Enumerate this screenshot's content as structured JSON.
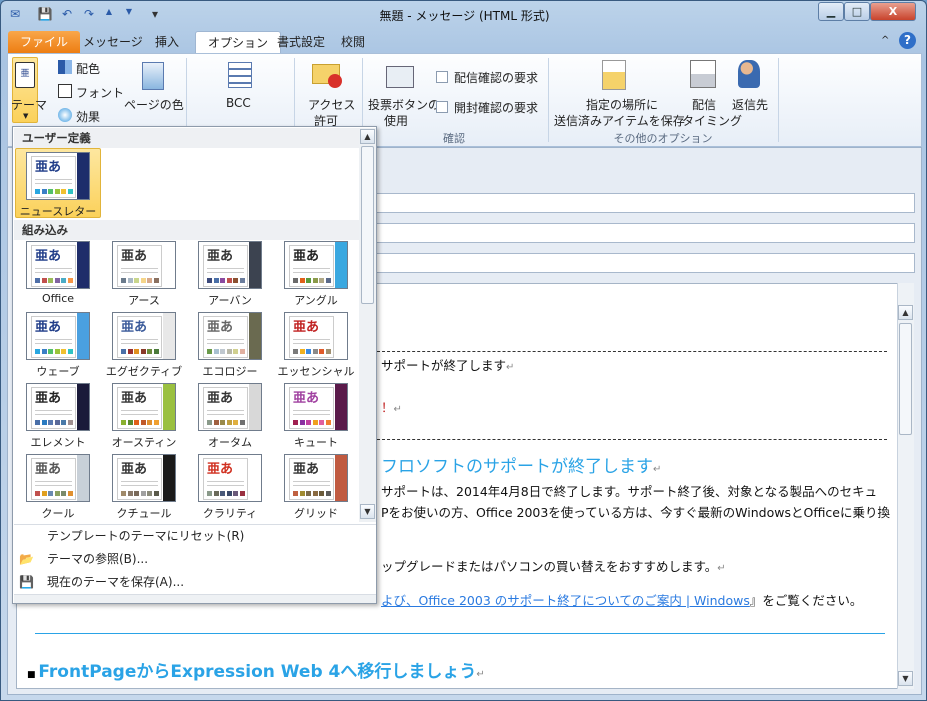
{
  "window": {
    "title": "無題 - メッセージ (HTML 形式)",
    "minimize": "▁",
    "maximize": "□",
    "close": "X"
  },
  "quick_access": [
    "✉",
    "💾",
    "↶",
    "↷",
    "▲",
    "▼",
    "▾"
  ],
  "tabs": [
    {
      "label": "ファイル"
    },
    {
      "label": "メッセージ"
    },
    {
      "label": "挿入"
    },
    {
      "label": "オプション"
    },
    {
      "label": "書式設定"
    },
    {
      "label": "校閲"
    }
  ],
  "help": "?",
  "collapse": "^",
  "ribbon": {
    "theme": "テーマ",
    "colors": "配色",
    "fonts": "フォント",
    "effects": "効果",
    "page_color": "ページの色",
    "bcc": "BCC",
    "permission_1": "アクセス",
    "permission_2": "許可",
    "voting_1": "投票ボタンの",
    "voting_2": "使用",
    "delivery_receipt": "配信確認の要求",
    "read_receipt": "開封確認の要求",
    "group_confirm": "確認",
    "save_sent_1": "指定の場所に",
    "save_sent_2": "送信済みアイテムを保存",
    "delay_1": "配信",
    "delay_2": "タイミング",
    "reply_to": "返信先",
    "group_more": "その他のオプション"
  },
  "dropdown": {
    "custom_header": "ユーザー定義",
    "builtin_header": "組み込み",
    "custom": [
      {
        "name": "ニュースレター",
        "text": "#1f3c88",
        "accent": "#1d2d6b",
        "swatches": [
          "#27a6e0",
          "#3a7fc6",
          "#52c06a",
          "#9bc43a",
          "#f0c030",
          "#2fc3c3"
        ]
      }
    ],
    "themes": [
      {
        "name": "Office",
        "text": "#1f3c88",
        "accent": "#1f2d6a",
        "swatches": [
          "#4f6fa8",
          "#c0504d",
          "#9bbb59",
          "#8064a2",
          "#4bacc6",
          "#f79646"
        ]
      },
      {
        "name": "アース",
        "text": "#333",
        "accent": "#ffffff",
        "swatches": [
          "#6b7b8c",
          "#a9b8c6",
          "#c9d68c",
          "#f5d58a",
          "#d6a88a",
          "#8a7060"
        ]
      },
      {
        "name": "アーバン",
        "text": "#333",
        "accent": "#3c4350",
        "swatches": [
          "#3c4a7c",
          "#4a6fa8",
          "#8a4aa0",
          "#c0504d",
          "#8b5030",
          "#6a7c9c"
        ]
      },
      {
        "name": "アングル",
        "text": "#222",
        "accent": "#3aa8e0",
        "swatches": [
          "#6a6a6a",
          "#e0601a",
          "#5a9a3a",
          "#8a9a4a",
          "#b0a888",
          "#5a6a8a"
        ]
      },
      {
        "name": "ウェーブ",
        "text": "#1f3c88",
        "accent": "#4aa0e0",
        "swatches": [
          "#27a6e0",
          "#3a7fc6",
          "#52c06a",
          "#9bc43a",
          "#f0c030",
          "#2fc3c3"
        ]
      },
      {
        "name": "エグゼクティブ",
        "text": "#3a5a9a",
        "accent": "#e8e8e8",
        "swatches": [
          "#4a6fa8",
          "#9b3030",
          "#e09020",
          "#8a3a2a",
          "#6a8a3a",
          "#4a7a3a"
        ]
      },
      {
        "name": "エコロジー",
        "text": "#666",
        "accent": "#6a6a50",
        "swatches": [
          "#6a9a4a",
          "#a8c0d0",
          "#c0c8d0",
          "#b8b8a8",
          "#d0d090",
          "#e0b0a0"
        ]
      },
      {
        "name": "エッセンシャル",
        "text": "#c02020",
        "accent": "#ffffff",
        "swatches": [
          "#7a7a7a",
          "#f0b020",
          "#3a8ae0",
          "#8a8a8a",
          "#e05a2a",
          "#a09070"
        ]
      },
      {
        "name": "エレメント",
        "text": "#222",
        "accent": "#1a1a3a",
        "swatches": [
          "#4a6fa8",
          "#2a7ac0",
          "#5a7ab0",
          "#5a6a9a",
          "#4a7aa8",
          "#a09090"
        ]
      },
      {
        "name": "オースティン",
        "text": "#333",
        "accent": "#9ac040",
        "swatches": [
          "#8ab030",
          "#5a8a30",
          "#e0601a",
          "#c05a2a",
          "#e09030",
          "#f0a030"
        ]
      },
      {
        "name": "オータム",
        "text": "#333",
        "accent": "#d8d8d8",
        "swatches": [
          "#8a9a8a",
          "#a06040",
          "#9a8a4a",
          "#c0a040",
          "#e0b040",
          "#707070"
        ]
      },
      {
        "name": "キュート",
        "text": "#a040a0",
        "accent": "#5a1a4a",
        "swatches": [
          "#a02050",
          "#8a30a0",
          "#c040a0",
          "#f0a020",
          "#e060a0",
          "#f08030"
        ]
      },
      {
        "name": "クール",
        "text": "#555",
        "accent": "#c8d0d8",
        "swatches": [
          "#c0504d",
          "#e0a020",
          "#6a8ab0",
          "#8aa060",
          "#7a8a6a",
          "#e09030"
        ]
      },
      {
        "name": "クチュール",
        "text": "#333",
        "accent": "#1a1a1a",
        "swatches": [
          "#a08a6a",
          "#8a7a6a",
          "#7a6a5a",
          "#a0a0a0",
          "#8a8a7a",
          "#5a5a4a"
        ]
      },
      {
        "name": "クラリティ",
        "text": "#d03020",
        "accent": "#ffffff",
        "swatches": [
          "#8a9a8a",
          "#6a6a5a",
          "#4a5a7a",
          "#3a4a6a",
          "#6a5a7a",
          "#9a3040"
        ]
      },
      {
        "name": "グリッド",
        "text": "#333",
        "accent": "#c05a40",
        "swatches": [
          "#c06040",
          "#a08a30",
          "#7a6a4a",
          "#8a6a40",
          "#6a5a3a",
          "#5a5a5a"
        ]
      }
    ],
    "menu": [
      {
        "label": "テンプレートのテーマにリセット(R)",
        "icon": ""
      },
      {
        "label": "テーマの参照(B)...",
        "icon": "📂"
      },
      {
        "label": "現在のテーマを保存(A)...",
        "icon": "💾"
      }
    ]
  },
  "body": {
    "line1": "サポートが終了します",
    "line2": "！",
    "heading1": "フロソフトのサポートが終了します",
    "para1": "サポートは、2014年4月8日で終了します。サポート終了後、対象となる製品へのセキュ",
    "para2": "Pをお使いの方、Office 2003を使っている方は、今すぐ最新のWindowsとOfficeに乗り換",
    "para3": "ップグレードまたはパソコンの買い替えをおすすめします。",
    "link": "よび、Office 2003 のサポート終了についてのご案内 | Windows",
    "link_after": "』をご覧ください。",
    "heading2": "FrontPageからExpression Web 4へ移行しましょう",
    "return_mark": "↵"
  },
  "colors": {
    "accent": "#2aa3e6",
    "file_tab": "#ec7b10"
  }
}
